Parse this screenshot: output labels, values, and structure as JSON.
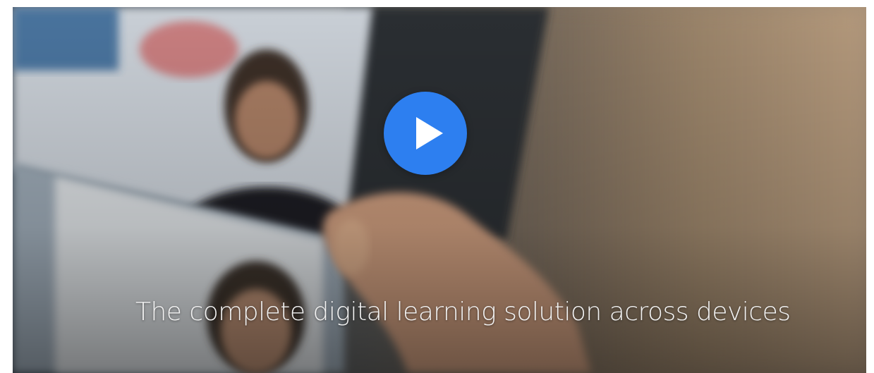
{
  "hero": {
    "caption": "The complete digital learning solution across devices",
    "play_icon": "play-icon",
    "accent_color": "#2d7ff0"
  }
}
